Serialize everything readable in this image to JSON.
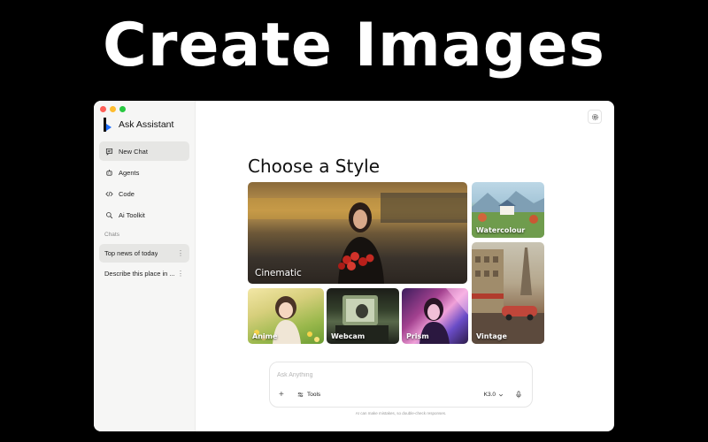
{
  "hero": {
    "title": "Create Images"
  },
  "app": {
    "name": "Ask Assistant"
  },
  "sidebar": {
    "nav": [
      {
        "label": "New Chat",
        "icon": "chat-icon"
      },
      {
        "label": "Agents",
        "icon": "agent-icon"
      },
      {
        "label": "Code",
        "icon": "code-icon"
      },
      {
        "label": "Ai Toolkit",
        "icon": "toolkit-icon"
      }
    ],
    "chats_label": "Chats",
    "chats": [
      {
        "label": "Top news of today"
      },
      {
        "label": "Describe this place in ..."
      }
    ]
  },
  "main": {
    "title": "Choose a Style",
    "styles": [
      {
        "label": "Cinematic"
      },
      {
        "label": "Watercolour"
      },
      {
        "label": "Vintage"
      },
      {
        "label": "Anime"
      },
      {
        "label": "Webcam"
      },
      {
        "label": "Prism"
      }
    ]
  },
  "composer": {
    "placeholder": "Ask Anything",
    "tools_label": "Tools",
    "model_label": "K3.0",
    "disclaimer": "AI can make mistakes, so double-check responses."
  },
  "colors": {
    "brand_blue": "#1f6fff",
    "sidebar_bg": "#f6f6f5",
    "active_item_bg": "#e6e6e4"
  }
}
